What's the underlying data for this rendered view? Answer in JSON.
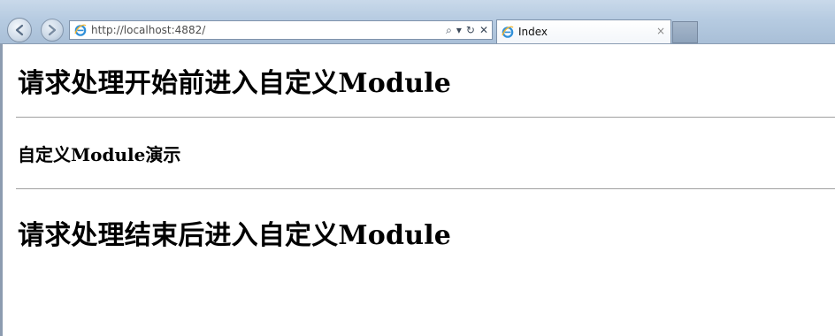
{
  "browser": {
    "address_url": "http://localhost:4882/",
    "tab_title": "Index",
    "tab_close": "×",
    "tools": {
      "search": "⌕",
      "dropdown": "▾",
      "refresh": "↻",
      "stop": "✕"
    }
  },
  "page": {
    "before_heading": "请求处理开始前进入自定义Module",
    "demo_title": "自定义Module演示",
    "after_heading": "请求处理结束后进入自定义Module"
  }
}
